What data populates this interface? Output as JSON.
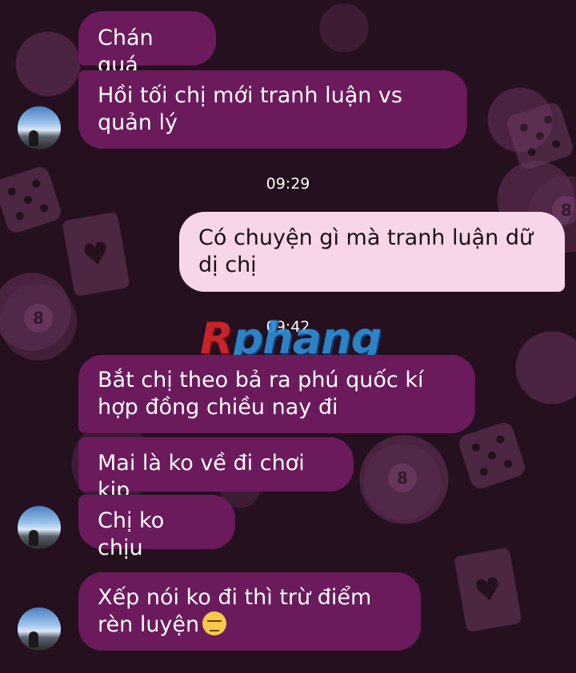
{
  "messages": {
    "m1": "Chán quá",
    "m2": "Hồi tối chị mới tranh luận vs quản lý",
    "time1": "09:29",
    "m3": "Có chuyện gì mà tranh luận dữ dị chị",
    "time2": "09:42",
    "m4": "Bắt chị theo bả ra phú quốc kí hợp đồng chiều nay đi",
    "m5": "Mai là ko về đi chơi kịp",
    "m6": "Chị ko chịu",
    "m7": "Xếp nói ko đi thì trừ điểm rèn luyện"
  },
  "watermark": {
    "r": "R",
    "rest": "phang"
  },
  "colors": {
    "incoming_bubble": "#6b1a5b",
    "outgoing_bubble": "#f6d6e8",
    "background": "#24101f"
  },
  "icons": {
    "emoji": "unamused-face-icon",
    "avatar": "contact-avatar-icon"
  }
}
